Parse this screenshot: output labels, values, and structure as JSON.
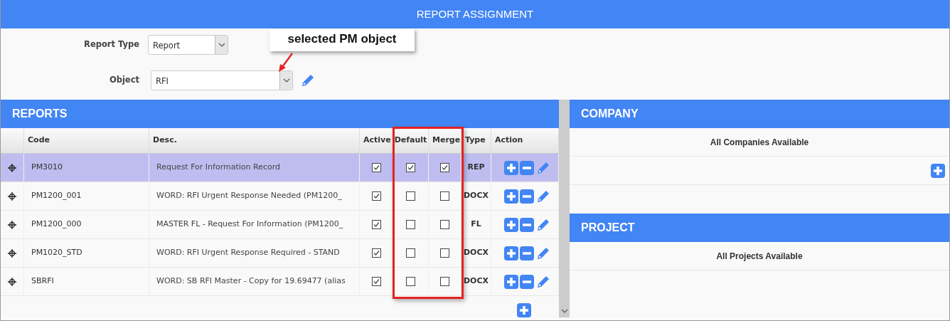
{
  "window": {
    "title": "REPORT ASSIGNMENT"
  },
  "form": {
    "fields": [
      {
        "label": "Report Type",
        "value": "Report",
        "kind": "short"
      },
      {
        "label": "Object",
        "value": "RFI",
        "kind": "long"
      }
    ]
  },
  "callout": {
    "text": "selected PM object"
  },
  "reports": {
    "title": "REPORTS",
    "columns": [
      "Code",
      "Desc.",
      "Active",
      "Default",
      "Merge",
      "Type",
      "Action"
    ],
    "rows": [
      {
        "code": "PM3010",
        "desc": "Request For Information Record",
        "active": true,
        "default": true,
        "merge": true,
        "type": "REP",
        "selected": true
      },
      {
        "code": "PM1200_001",
        "desc": "WORD: RFI Urgent Response Needed (PM1200_",
        "active": true,
        "default": false,
        "merge": false,
        "type": "DOCX",
        "selected": false
      },
      {
        "code": "PM1200_000",
        "desc": "MASTER FL - Request For Information (PM1200_",
        "active": true,
        "default": false,
        "merge": false,
        "type": "FL",
        "selected": false
      },
      {
        "code": "PM1020_STD",
        "desc": "WORD: RFI Urgent Response Required - STAND",
        "active": true,
        "default": false,
        "merge": false,
        "type": "DOCX",
        "selected": false
      },
      {
        "code": "SBRFI",
        "desc": "WORD: SB RFI Master - Copy for 19.69477 (alias",
        "active": true,
        "default": false,
        "merge": false,
        "type": "DOCX",
        "selected": false
      }
    ]
  },
  "company": {
    "title": "COMPANY",
    "text": "All Companies Available"
  },
  "project": {
    "title": "PROJECT",
    "text": "All Projects Available"
  }
}
